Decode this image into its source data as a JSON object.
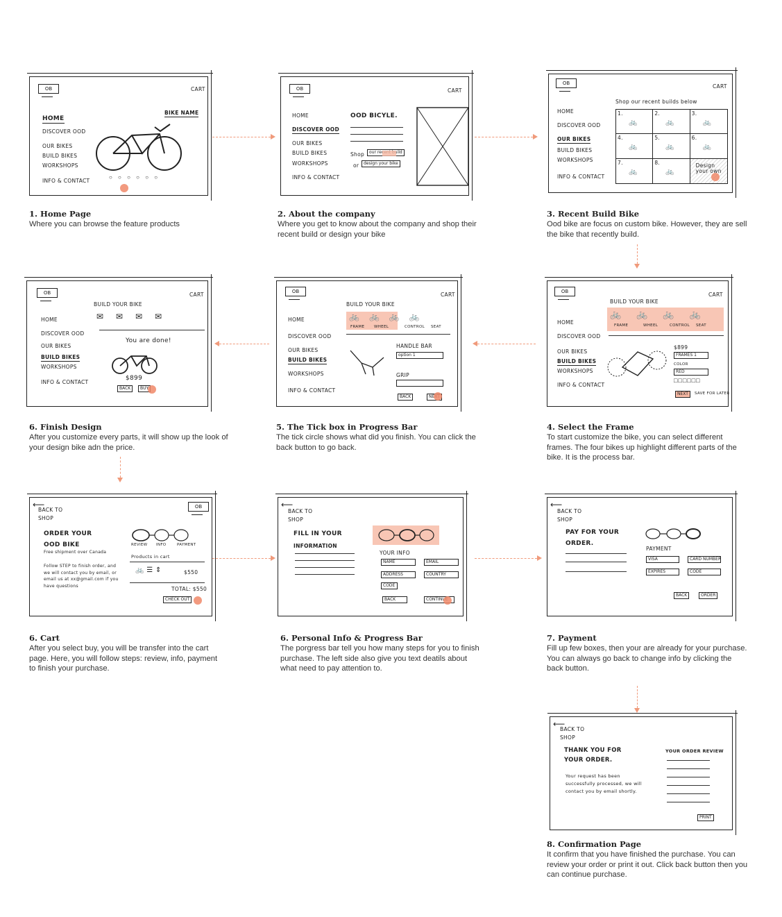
{
  "accent_color": "#f09a7b",
  "common": {
    "logo": "OB",
    "cart": "CART",
    "nav": {
      "home": "HOME",
      "discover": "DISCOVER OOD",
      "our_bikes": "OUR BIKES",
      "build_bikes": "BUILD BIKES",
      "workshops": "WORKSHOPS",
      "info": "INFO & CONTACT"
    },
    "back_to_shop": [
      "BACK TO",
      "SHOP"
    ]
  },
  "screens": {
    "s1": {
      "bike_name": "BIKE NAME"
    },
    "s2": {
      "heading": "OOD BICYLE.",
      "shop_prefix": "Shop",
      "shop_button": "our recent build",
      "or_prefix": "or",
      "design_button": "design your bike"
    },
    "s3": {
      "heading": "Shop our recent builds below",
      "cells": [
        "1.",
        "2.",
        "3.",
        "4.",
        "5.",
        "6.",
        "7.",
        "8."
      ],
      "design_cell": "Design your own"
    },
    "s4": {
      "title": "BUILD YOUR BIKE",
      "tabs": [
        "FRAME",
        "WHEEL",
        "CONTROL",
        "SEAT"
      ],
      "price": "$899",
      "select1": "FRAMES 1",
      "color_label": "COLOR",
      "select2": "RED",
      "next": "NEXT",
      "save": "SAVE FOR LATER"
    },
    "s5": {
      "title": "BUILD YOUR BIKE",
      "tabs": [
        "FRAME",
        "WHEEL",
        "CONTROL",
        "SEAT"
      ],
      "handle_label": "HANDLE BAR",
      "handle_select": "option 1",
      "grip_label": "GRIP",
      "back": "BACK",
      "next": "NEXT"
    },
    "s6": {
      "title": "BUILD YOUR BIKE",
      "done": "You are done!",
      "price": "$899",
      "back": "BACK",
      "buy": "BUY"
    },
    "s7": {
      "title_line1": "ORDER YOUR",
      "title_line2": "OOD BIKE",
      "subtitle": "Free shipment over Canada",
      "steps": [
        "REVIEW",
        "INFO",
        "PAYMENT"
      ],
      "products_label": "Products in cart",
      "item_price": "$550",
      "body": "Follow STEP to finish order, and we will contact you by email, or email us at xx@gmail.com if you have questions",
      "total": "TOTAL: $550",
      "checkout": "CHECK OUT"
    },
    "s8": {
      "title_line1": "FILL IN YOUR",
      "title_line2": "INFORMATION",
      "your_info": "YOUR INFO",
      "fields": [
        "NAME",
        "EMAIL",
        "ADDRESS",
        "COUNTRY",
        "CODE"
      ],
      "back": "BACK",
      "continue": "CONTINUE"
    },
    "s9": {
      "title_line1": "PAY FOR YOUR",
      "title_line2": "ORDER.",
      "payment_label": "PAYMENT",
      "selects": [
        "VISA",
        "CARD NUMBER",
        "EXPIRES",
        "CODE"
      ],
      "back": "BACK",
      "order": "ORDER"
    },
    "s10": {
      "title_line1": "THANK YOU FOR",
      "title_line2": "YOUR ORDER.",
      "review_label": "YOUR ORDER REVIEW",
      "body": "Your request has been successfully processed, we will contact you by email shortly.",
      "print": "PRINT"
    }
  },
  "captions": [
    {
      "title": "1. Home Page",
      "desc": "Where you can browse the feature products"
    },
    {
      "title": "2. About the company",
      "desc": "Where you get to know about the company and shop their recent build or design your bike"
    },
    {
      "title": "3. Recent Build Bike",
      "desc": "Ood bike are focus on custom bike. However, they are sell the bike that recently build."
    },
    {
      "title": "6. Finish Design",
      "desc": "After you customize every parts, it will show up the look of your design bike adn the price."
    },
    {
      "title": "5. The Tick box in Progress Bar",
      "desc": "The tick circle shows what did you finish. You can click the back button to go back."
    },
    {
      "title": "4. Select the Frame",
      "desc": "To start customize the bike, you can select different frames. The four bikes up highlight different parts of the bike. It is the process bar."
    },
    {
      "title": "6. Cart",
      "desc": "After you select buy, you will be transfer into the cart page. Here, you will follow steps: review, info, payment to finish your purchase."
    },
    {
      "title": "6. Personal Info & Progress Bar",
      "desc": "The porgress bar tell you how many steps for you to finish purchase. The left side also give you text deatils about what need to pay attention to."
    },
    {
      "title": "7. Payment",
      "desc": "Fill up few boxes, then your are already for your purchase. You can always go back to change info by clicking the back button."
    },
    {
      "title": "8. Confirmation Page",
      "desc": "It confirm that you have finished  the purchase. You can review your order or print it out. Click back button then you can continue purchase."
    }
  ]
}
